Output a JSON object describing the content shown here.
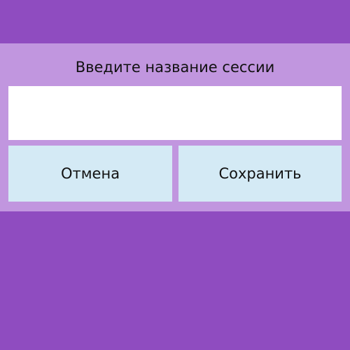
{
  "dialog": {
    "prompt": "Введите название сессии",
    "input_value": "",
    "cancel_label": "Отмена",
    "save_label": "Сохранить"
  },
  "colors": {
    "background": "#8f4cc0",
    "dialog_background": "#c196df",
    "input_background": "#ffffff",
    "button_background": "#d4eaf5"
  }
}
